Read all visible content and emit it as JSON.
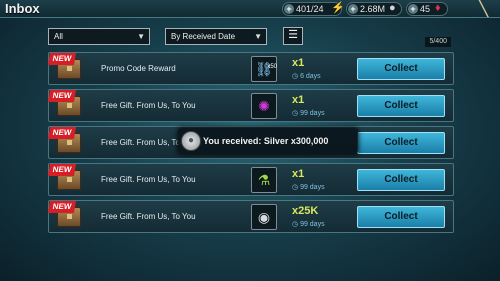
{
  "header": {
    "title": "Inbox",
    "energy": "401/24",
    "silver": "2.68M",
    "gems": "45"
  },
  "filters": {
    "type_filter": "All",
    "sort_filter": "By Received Date",
    "count": "5/400"
  },
  "messages": [
    {
      "new_label": "NEW",
      "subject": "Promo Code Reward",
      "item_icon": "chain-ring-icon",
      "item_badge": "x50",
      "quantity": "x1",
      "days": "6 days",
      "button": "Collect"
    },
    {
      "new_label": "NEW",
      "subject": "Free Gift. From Us, To You",
      "item_icon": "purple-gem-icon",
      "quantity": "x1",
      "days": "99 days",
      "button": "Collect"
    },
    {
      "new_label": "NEW",
      "subject": "Free Gift. From Us, To You",
      "item_icon": "silver-coin-icon",
      "quantity": "",
      "days": "",
      "button": "Collect"
    },
    {
      "new_label": "NEW",
      "subject": "Free Gift. From Us, To You",
      "item_icon": "potion-icon",
      "quantity": "x1",
      "days": "99 days",
      "button": "Collect"
    },
    {
      "new_label": "NEW",
      "subject": "Free Gift. From Us, To You",
      "item_icon": "silver-coins-icon",
      "quantity": "x25K",
      "days": "99 days",
      "button": "Collect"
    }
  ],
  "toast": {
    "message": "You received: Silver x300,000"
  },
  "colors": {
    "collect_button": "#2a9cc6",
    "new_badge": "#d51e25",
    "quantity": "#d7e85a"
  }
}
